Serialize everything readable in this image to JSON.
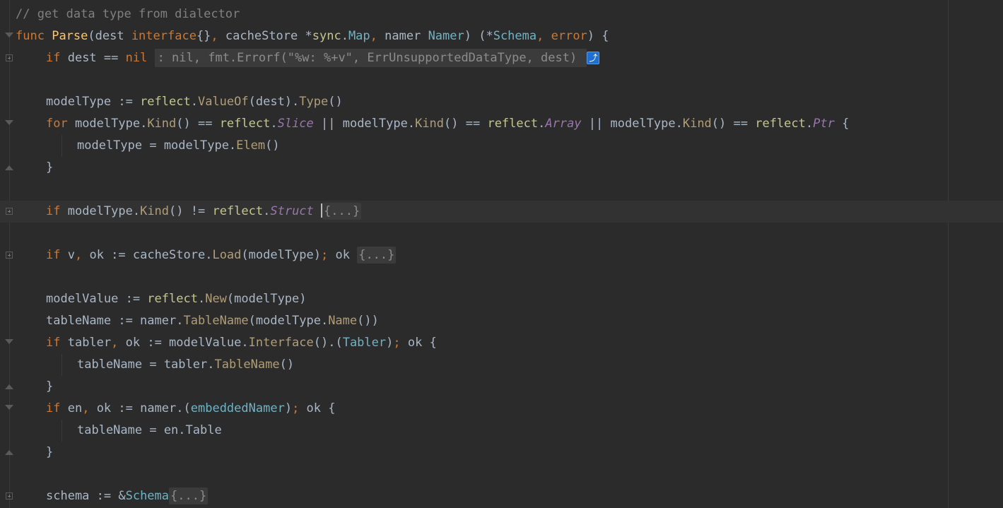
{
  "editor": {
    "lines": [
      {
        "fold": "",
        "indent": 0,
        "current": false,
        "tokens": [
          {
            "t": "// get data type from dialector",
            "c": "cmt"
          }
        ]
      },
      {
        "fold": "open",
        "indent": 0,
        "current": false,
        "tokens": [
          {
            "t": "func",
            "c": "kw"
          },
          {
            "t": " ",
            "c": "txt"
          },
          {
            "t": "Parse",
            "c": "fn"
          },
          {
            "t": "(dest ",
            "c": "txt"
          },
          {
            "t": "interface",
            "c": "kw"
          },
          {
            "t": "{}",
            "c": "txt"
          },
          {
            "t": ", ",
            "c": "kw"
          },
          {
            "t": "cacheStore *",
            "c": "txt"
          },
          {
            "t": "sync",
            "c": "pkg"
          },
          {
            "t": ".",
            "c": "txt"
          },
          {
            "t": "Map",
            "c": "typ"
          },
          {
            "t": ", ",
            "c": "kw"
          },
          {
            "t": "namer ",
            "c": "txt"
          },
          {
            "t": "Namer",
            "c": "typ"
          },
          {
            "t": ") (*",
            "c": "txt"
          },
          {
            "t": "Schema",
            "c": "typ"
          },
          {
            "t": ", ",
            "c": "kw"
          },
          {
            "t": "error",
            "c": "kw"
          },
          {
            "t": ") {",
            "c": "txt"
          }
        ]
      },
      {
        "fold": "plus",
        "indent": 1,
        "current": false,
        "tokens": [
          {
            "t": "if",
            "c": "kw"
          },
          {
            "t": " dest == ",
            "c": "txt"
          },
          {
            "t": "nil",
            "c": "kw"
          },
          {
            "t": " ",
            "c": "txt"
          },
          {
            "t": ": nil, fmt.Errorf(\"%w: %+v\", ErrUnsupportedDataType, dest) ",
            "c": "inline"
          },
          {
            "t": "⤴",
            "c": "navbtn"
          }
        ]
      },
      {
        "fold": "",
        "indent": 0,
        "current": false,
        "tokens": []
      },
      {
        "fold": "",
        "indent": 1,
        "current": false,
        "tokens": [
          {
            "t": "modelType := ",
            "c": "txt"
          },
          {
            "t": "reflect",
            "c": "pkg"
          },
          {
            "t": ".",
            "c": "txt"
          },
          {
            "t": "ValueOf",
            "c": "call"
          },
          {
            "t": "(dest).",
            "c": "txt"
          },
          {
            "t": "Type",
            "c": "call"
          },
          {
            "t": "()",
            "c": "txt"
          }
        ]
      },
      {
        "fold": "open",
        "indent": 1,
        "current": false,
        "tokens": [
          {
            "t": "for",
            "c": "kw"
          },
          {
            "t": " modelType.",
            "c": "txt"
          },
          {
            "t": "Kind",
            "c": "call"
          },
          {
            "t": "() == ",
            "c": "txt"
          },
          {
            "t": "reflect",
            "c": "pkg"
          },
          {
            "t": ".",
            "c": "txt"
          },
          {
            "t": "Slice",
            "c": "const"
          },
          {
            "t": " || modelType.",
            "c": "txt"
          },
          {
            "t": "Kind",
            "c": "call"
          },
          {
            "t": "() == ",
            "c": "txt"
          },
          {
            "t": "reflect",
            "c": "pkg"
          },
          {
            "t": ".",
            "c": "txt"
          },
          {
            "t": "Array",
            "c": "const"
          },
          {
            "t": " || modelType.",
            "c": "txt"
          },
          {
            "t": "Kind",
            "c": "call"
          },
          {
            "t": "() == ",
            "c": "txt"
          },
          {
            "t": "reflect",
            "c": "pkg"
          },
          {
            "t": ".",
            "c": "txt"
          },
          {
            "t": "Ptr",
            "c": "const"
          },
          {
            "t": " {",
            "c": "txt"
          }
        ]
      },
      {
        "fold": "",
        "indent": 2,
        "current": false,
        "tokens": [
          {
            "t": "modelType = modelType.",
            "c": "txt"
          },
          {
            "t": "Elem",
            "c": "call"
          },
          {
            "t": "()",
            "c": "txt"
          }
        ]
      },
      {
        "fold": "close",
        "indent": 1,
        "current": false,
        "tokens": [
          {
            "t": "}",
            "c": "txt"
          }
        ]
      },
      {
        "fold": "",
        "indent": 0,
        "current": false,
        "tokens": []
      },
      {
        "fold": "plus",
        "indent": 1,
        "current": true,
        "tokens": [
          {
            "t": "if",
            "c": "kw"
          },
          {
            "t": " modelType.",
            "c": "txt"
          },
          {
            "t": "Kind",
            "c": "call"
          },
          {
            "t": "() != ",
            "c": "txt"
          },
          {
            "t": "reflect",
            "c": "pkg"
          },
          {
            "t": ".",
            "c": "txt"
          },
          {
            "t": "Struct",
            "c": "const"
          },
          {
            "t": " ",
            "c": "txt"
          },
          {
            "t": "",
            "c": "caret"
          },
          {
            "t": "{...}",
            "c": "foldchip"
          }
        ]
      },
      {
        "fold": "",
        "indent": 0,
        "current": false,
        "tokens": []
      },
      {
        "fold": "plus",
        "indent": 1,
        "current": false,
        "tokens": [
          {
            "t": "if",
            "c": "kw"
          },
          {
            "t": " v",
            "c": "txt"
          },
          {
            "t": ", ",
            "c": "kw"
          },
          {
            "t": "ok := cacheStore.",
            "c": "txt"
          },
          {
            "t": "Load",
            "c": "call"
          },
          {
            "t": "(modelType)",
            "c": "txt"
          },
          {
            "t": "; ",
            "c": "kw"
          },
          {
            "t": "ok ",
            "c": "txt"
          },
          {
            "t": "{...}",
            "c": "foldchip"
          }
        ]
      },
      {
        "fold": "",
        "indent": 0,
        "current": false,
        "tokens": []
      },
      {
        "fold": "",
        "indent": 1,
        "current": false,
        "tokens": [
          {
            "t": "modelValue := ",
            "c": "txt"
          },
          {
            "t": "reflect",
            "c": "pkg"
          },
          {
            "t": ".",
            "c": "txt"
          },
          {
            "t": "New",
            "c": "call"
          },
          {
            "t": "(modelType)",
            "c": "txt"
          }
        ]
      },
      {
        "fold": "",
        "indent": 1,
        "current": false,
        "tokens": [
          {
            "t": "tableName := namer.",
            "c": "txt"
          },
          {
            "t": "TableName",
            "c": "call"
          },
          {
            "t": "(modelType.",
            "c": "txt"
          },
          {
            "t": "Name",
            "c": "call"
          },
          {
            "t": "())",
            "c": "txt"
          }
        ]
      },
      {
        "fold": "open",
        "indent": 1,
        "current": false,
        "tokens": [
          {
            "t": "if",
            "c": "kw"
          },
          {
            "t": " tabler",
            "c": "txt"
          },
          {
            "t": ", ",
            "c": "kw"
          },
          {
            "t": "ok := modelValue.",
            "c": "txt"
          },
          {
            "t": "Interface",
            "c": "call"
          },
          {
            "t": "().(",
            "c": "txt"
          },
          {
            "t": "Tabler",
            "c": "typ"
          },
          {
            "t": ")",
            "c": "txt"
          },
          {
            "t": "; ",
            "c": "kw"
          },
          {
            "t": "ok {",
            "c": "txt"
          }
        ]
      },
      {
        "fold": "",
        "indent": 2,
        "current": false,
        "tokens": [
          {
            "t": "tableName = tabler.",
            "c": "txt"
          },
          {
            "t": "TableName",
            "c": "call"
          },
          {
            "t": "()",
            "c": "txt"
          }
        ]
      },
      {
        "fold": "close",
        "indent": 1,
        "current": false,
        "tokens": [
          {
            "t": "}",
            "c": "txt"
          }
        ]
      },
      {
        "fold": "open",
        "indent": 1,
        "current": false,
        "tokens": [
          {
            "t": "if",
            "c": "kw"
          },
          {
            "t": " en",
            "c": "txt"
          },
          {
            "t": ", ",
            "c": "kw"
          },
          {
            "t": "ok := namer.(",
            "c": "txt"
          },
          {
            "t": "embeddedNamer",
            "c": "typ"
          },
          {
            "t": ")",
            "c": "txt"
          },
          {
            "t": "; ",
            "c": "kw"
          },
          {
            "t": "ok {",
            "c": "txt"
          }
        ]
      },
      {
        "fold": "",
        "indent": 2,
        "current": false,
        "tokens": [
          {
            "t": "tableName = en.Table",
            "c": "txt"
          }
        ]
      },
      {
        "fold": "close",
        "indent": 1,
        "current": false,
        "tokens": [
          {
            "t": "}",
            "c": "txt"
          }
        ]
      },
      {
        "fold": "",
        "indent": 0,
        "current": false,
        "tokens": []
      },
      {
        "fold": "plus",
        "indent": 1,
        "current": false,
        "tokens": [
          {
            "t": "schema := &",
            "c": "txt"
          },
          {
            "t": "Schema",
            "c": "typ"
          },
          {
            "t": "{...}",
            "c": "foldchip"
          }
        ]
      }
    ]
  }
}
